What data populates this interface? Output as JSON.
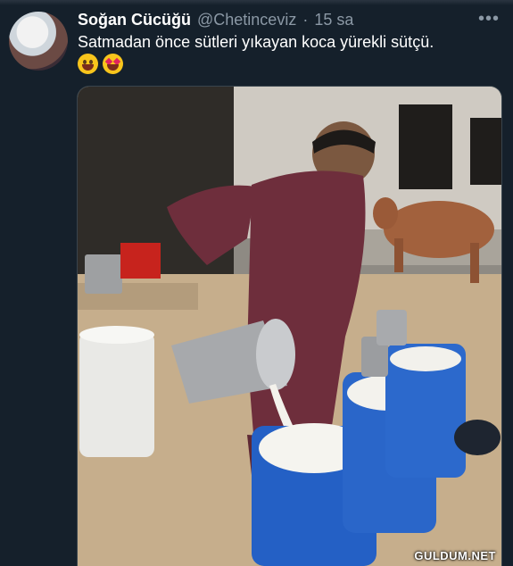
{
  "tweet": {
    "author_name": "Soğan Cücüğü",
    "handle": "@Chetinceviz",
    "separator": "·",
    "time": "15 sa",
    "more": "•••",
    "text": "Satmadan önce sütleri yıkayan koca yürekli sütçü.",
    "emojis": [
      "grinning-face",
      "heart-eyes-face"
    ]
  },
  "watermark": "GULDUM.NET"
}
